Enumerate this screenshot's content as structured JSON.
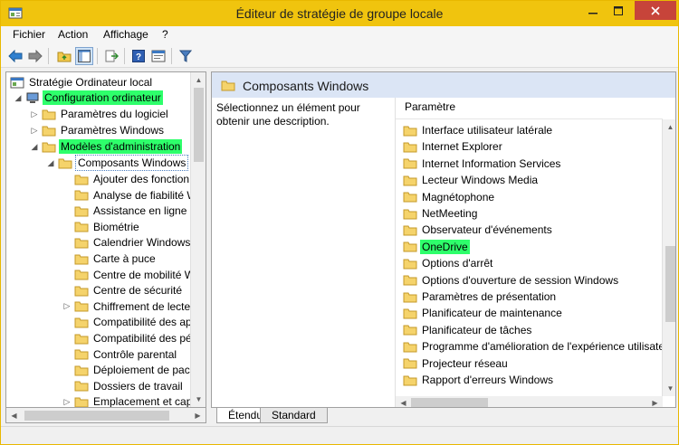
{
  "window": {
    "title": "Éditeur de stratégie de groupe locale"
  },
  "menu": [
    "Fichier",
    "Action",
    "Affichage",
    "?"
  ],
  "tree": {
    "root": "Stratégie Ordinateur local",
    "computer_config": "Configuration ordinateur",
    "software_settings": "Paramètres du logiciel",
    "windows_settings": "Paramètres Windows",
    "admin_templates": "Modèles d'administration",
    "windows_components": "Composants Windows",
    "children": [
      "Ajouter des fonction",
      "Analyse de fiabilité W",
      "Assistance en ligne",
      "Biométrie",
      "Calendrier Windows",
      "Carte à puce",
      "Centre de mobilité W",
      "Centre de sécurité",
      "Chiffrement de lecte",
      "Compatibilité des ap",
      "Compatibilité des pé",
      "Contrôle parental",
      "Déploiement de pacl",
      "Dossiers de travail",
      "Emplacement et cap"
    ]
  },
  "right": {
    "title": "Composants Windows",
    "description": "Sélectionnez un élément pour obtenir une description.",
    "column_header": "Paramètre",
    "items": [
      "Interface utilisateur latérale",
      "Internet Explorer",
      "Internet Information Services",
      "Lecteur Windows Media",
      "Magnétophone",
      "NetMeeting",
      "Observateur d'événements",
      "OneDrive",
      "Options d'arrêt",
      "Options d'ouverture de session Windows",
      "Paramètres de présentation",
      "Planificateur de maintenance",
      "Planificateur de tâches",
      "Programme d'amélioration de l'expérience utilisateu",
      "Projecteur réseau",
      "Rapport d'erreurs Windows"
    ]
  },
  "tabs": [
    "Étendu",
    "Standard"
  ],
  "colors": {
    "titlebar": "#f0c40e",
    "highlight": "#2eff6b",
    "close": "#c7443a"
  }
}
